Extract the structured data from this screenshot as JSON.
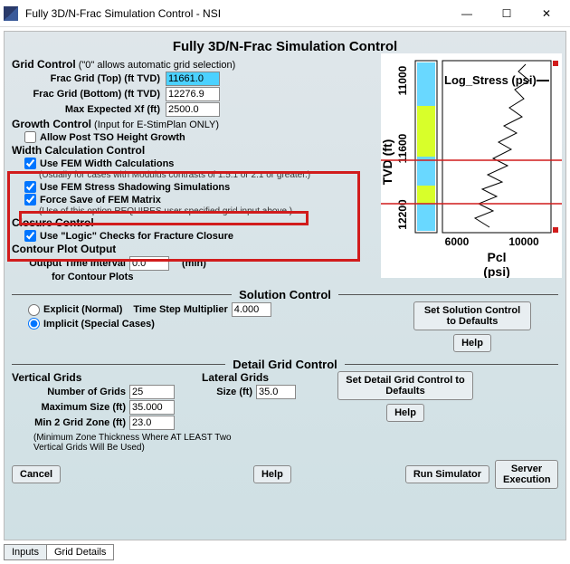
{
  "window": {
    "title": "Fully 3D/N-Frac Simulation Control - NSI"
  },
  "page_title": "Fully 3D/N-Frac Simulation Control",
  "grid_control": {
    "heading": "Grid Control",
    "note": " (\"0\" allows automatic grid selection)",
    "top_label": "Frac Grid (Top) (ft TVD)",
    "top_value": "11661.0",
    "bottom_label": "Frac Grid (Bottom) (ft TVD)",
    "bottom_value": "12276.9",
    "maxxf_label": "Max Expected Xf (ft)",
    "maxxf_value": "2500.0"
  },
  "growth_control": {
    "heading": "Growth Control",
    "note": " (Input for E-StimPlan ONLY)",
    "allow_tso": "Allow Post TSO Height Growth"
  },
  "width_control": {
    "heading": "Width Calculation Control",
    "use_fem_width": "Use FEM Width Calculations",
    "hint1": "(Usually for cases with Modulus contrasts of 1.5:1 or 2:1 or greater.)",
    "use_fem_stress": "Use FEM Stress Shadowing Simulations",
    "force_save": "Force Save of FEM Matrix",
    "hint2": "(Use of this option REQUIRES user specified grid input above.)"
  },
  "closure_control": {
    "heading": "Closure Control",
    "use_logic": "Use \"Logic\" Checks for Fracture Closure"
  },
  "contour": {
    "heading": "Contour Plot Output",
    "label": "Output Time Interval",
    "value": "0.0",
    "unit": "(min)",
    "sub": "for Contour Plots"
  },
  "solution": {
    "heading": "Solution Control",
    "explicit": "Explicit (Normal)",
    "implicit": "Implicit (Special Cases)",
    "tsm_label": "Time Step Multiplier",
    "tsm_value": "4.000",
    "set_defaults": "Set Solution Control to Defaults",
    "help": "Help"
  },
  "detail": {
    "heading": "Detail Grid Control",
    "vert_heading": "Vertical Grids",
    "lat_heading": "Lateral Grids",
    "num_label": "Number of Grids",
    "num_value": "25",
    "max_label": "Maximum Size (ft)",
    "max_value": "35.000",
    "min2_label": "Min 2 Grid Zone (ft)",
    "min2_value": "23.0",
    "lat_size_label": "Size (ft)",
    "lat_size_value": "35.0",
    "hint": "(Minimum Zone Thickness Where AT LEAST Two Vertical Grids Will Be Used)",
    "set_defaults": "Set Detail Grid Control to Defaults",
    "help": "Help"
  },
  "buttons": {
    "cancel": "Cancel",
    "help": "Help",
    "run": "Run Simulator",
    "server": "Server Execution"
  },
  "tabs": {
    "inputs": "Inputs",
    "grid_details": "Grid Details"
  },
  "chart": {
    "ylabel": "TVD (ft)",
    "xlabel": "Pcl (psi)",
    "series": "Log_Stress (psi)",
    "yticks": [
      "11000",
      "11600",
      "12200"
    ],
    "xticks": [
      "6000",
      "10000"
    ]
  },
  "chart_data": {
    "type": "line",
    "title": "",
    "xlabel": "Pcl (psi)",
    "ylabel": "TVD (ft)",
    "ylim": [
      11000,
      12300
    ],
    "xlim": [
      5500,
      10500
    ],
    "series": [
      {
        "name": "Log_Stress (psi)",
        "note": "irregular well-log trace; approx depth vs closure stress",
        "x": [
          9200,
          9100,
          9300,
          9000,
          8800,
          9200,
          8500,
          8800,
          8000,
          8300,
          7800,
          8200,
          7600,
          8000,
          7400,
          7800,
          7200,
          7600,
          7000,
          7400
        ],
        "y": [
          11000,
          11060,
          11120,
          11180,
          11240,
          11300,
          11360,
          11420,
          11480,
          11540,
          11600,
          11660,
          11720,
          11780,
          11840,
          11900,
          11960,
          12020,
          12080,
          12200
        ]
      }
    ],
    "lithology_track": [
      {
        "from": 11000,
        "to": 11320,
        "color": "#69d8ff"
      },
      {
        "from": 11320,
        "to": 11700,
        "color": "#d8ff2a"
      },
      {
        "from": 11700,
        "to": 11920,
        "color": "#69d8ff"
      },
      {
        "from": 11920,
        "to": 12060,
        "color": "#d8ff2a"
      },
      {
        "from": 12060,
        "to": 12300,
        "color": "#69d8ff"
      }
    ]
  }
}
